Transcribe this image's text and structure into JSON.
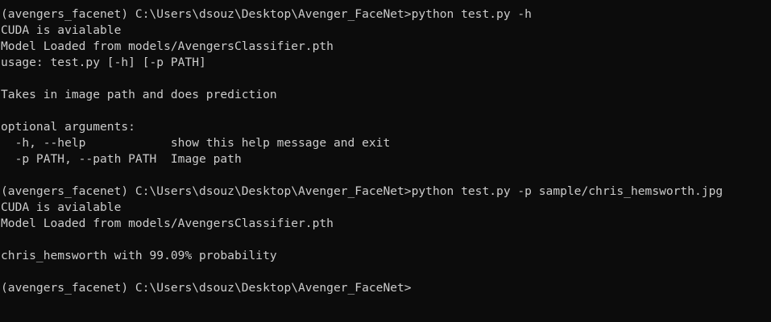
{
  "colors": {
    "background": "#0c0c0c",
    "foreground": "#cccccc"
  },
  "terminal": {
    "lines": [
      "(avengers_facenet) C:\\Users\\dsouz\\Desktop\\Avenger_FaceNet>python test.py -h",
      "CUDA is avialable",
      "Model Loaded from models/AvengersClassifier.pth",
      "usage: test.py [-h] [-p PATH]",
      "",
      "Takes in image path and does prediction",
      "",
      "optional arguments:",
      "  -h, --help            show this help message and exit",
      "  -p PATH, --path PATH  Image path",
      "",
      "(avengers_facenet) C:\\Users\\dsouz\\Desktop\\Avenger_FaceNet>python test.py -p sample/chris_hemsworth.jpg",
      "CUDA is avialable",
      "Model Loaded from models/AvengersClassifier.pth",
      "",
      "chris_hemsworth with 99.09% probability",
      "",
      "(avengers_facenet) C:\\Users\\dsouz\\Desktop\\Avenger_FaceNet>"
    ]
  }
}
